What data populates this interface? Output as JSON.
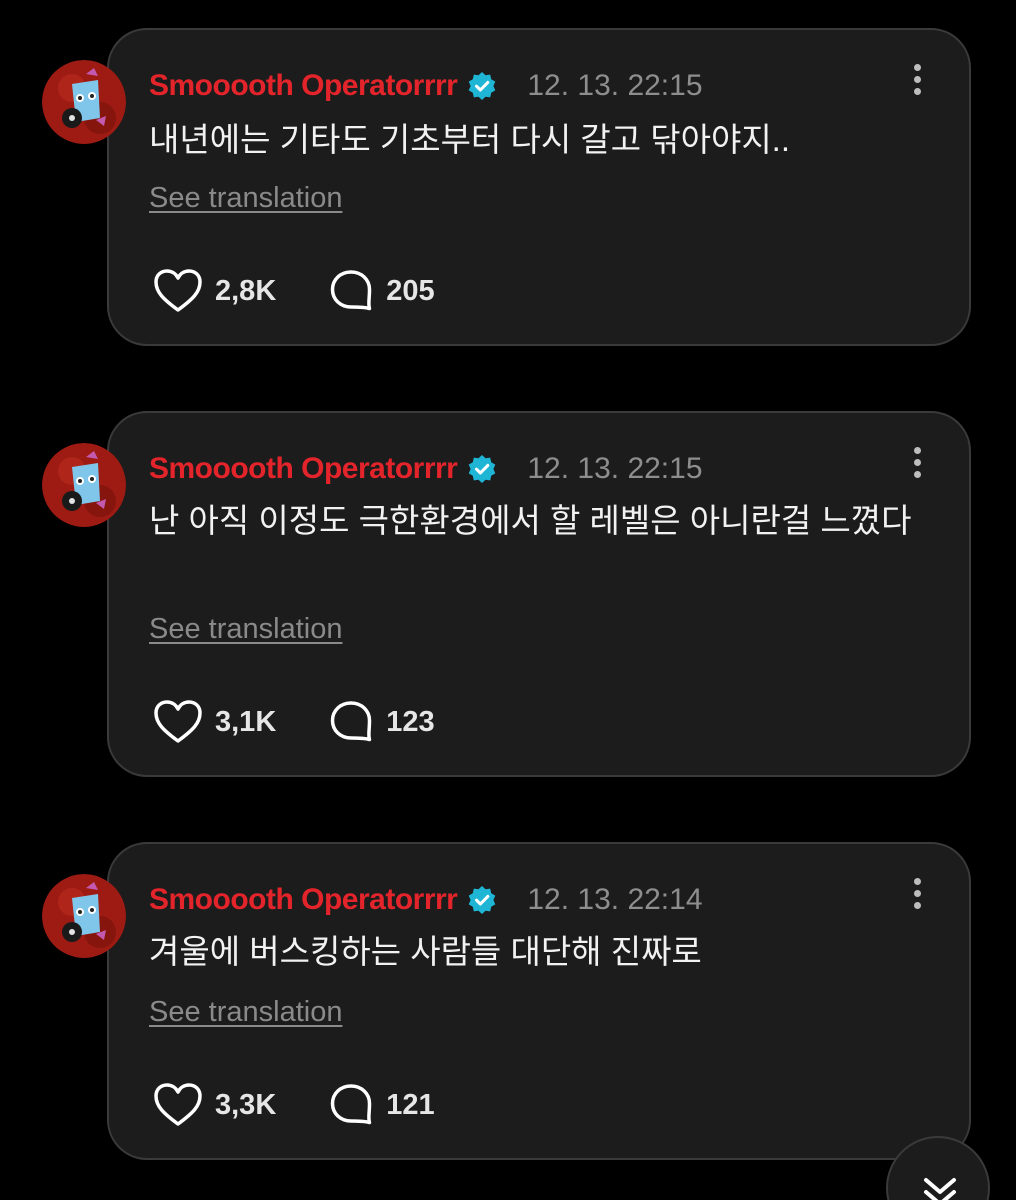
{
  "posts": [
    {
      "username": "Smooooth Operatorrrr",
      "timestamp": "12. 13. 22:15",
      "content": "내년에는 기타도 기초부터 다시 갈고 닦아야지..",
      "translate_label": "See translation",
      "likes": "2,8K",
      "comments": "205"
    },
    {
      "username": "Smooooth Operatorrrr",
      "timestamp": "12. 13. 22:15",
      "content": "난 아직 이정도 극한환경에서 할 레벨은 아니란걸 느꼈다",
      "translate_label": "See translation",
      "likes": "3,1K",
      "comments": "123"
    },
    {
      "username": "Smooooth Operatorrrr",
      "timestamp": "12. 13. 22:14",
      "content": "겨울에 버스킹하는 사람들 대단해 진짜로",
      "translate_label": "See translation",
      "likes": "3,3K",
      "comments": "121"
    }
  ],
  "icons": {
    "verified": "verified-badge-icon",
    "more": "more-vertical-icon",
    "like": "heart-icon",
    "comment": "comment-bubble-icon",
    "scroll": "double-chevron-down-icon"
  },
  "colors": {
    "username": "#e3242b",
    "verified": "#1fb6d6",
    "card_bg": "#1c1c1c",
    "page_bg": "#000000",
    "timestamp": "#8e8e8e"
  }
}
